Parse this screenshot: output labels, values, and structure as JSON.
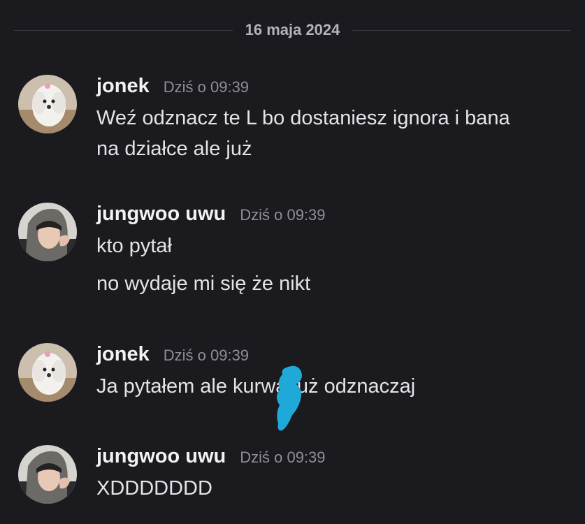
{
  "date_divider": "16 maja 2024",
  "messages": [
    {
      "username": "jonek",
      "timestamp": "Dziś o 09:39",
      "avatar": "dog-avatar",
      "lines": [
        "Weź odznacz te L bo dostaniesz ignora i bana",
        "na działce ale już"
      ]
    },
    {
      "username": "jungwoo uwu",
      "timestamp": "Dziś o 09:39",
      "avatar": "person-avatar",
      "lines": [
        "kto pytał",
        "no wydaje mi się że nikt"
      ]
    },
    {
      "username": "jonek",
      "timestamp": "Dziś o 09:39",
      "avatar": "dog-avatar",
      "lines": [
        "Ja pytałem ale kurwa już odznaczaj"
      ]
    },
    {
      "username": "jungwoo uwu",
      "timestamp": "Dziś o 09:39",
      "avatar": "person-avatar",
      "lines": [
        "XDDDDDDD"
      ]
    }
  ],
  "colors": {
    "background": "#1a1a1f",
    "username": "#f2f2f5",
    "timestamp": "#8e8f98",
    "message_text": "#e3e3e8",
    "scribble": "#1fa9d8"
  }
}
